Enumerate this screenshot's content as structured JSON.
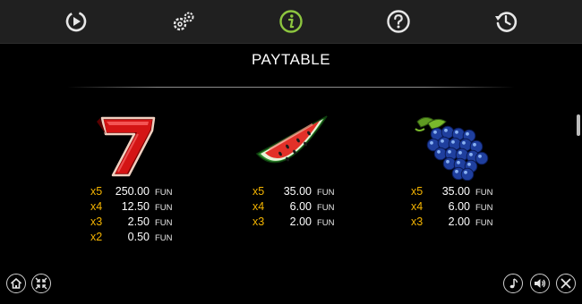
{
  "nav": [
    {
      "id": "autoplay",
      "icon": "replay-icon"
    },
    {
      "id": "settings",
      "icon": "gears-icon"
    },
    {
      "id": "info",
      "icon": "info-icon",
      "active": true,
      "color": "#8dc63f"
    },
    {
      "id": "help",
      "icon": "help-icon"
    },
    {
      "id": "history",
      "icon": "history-icon"
    }
  ],
  "title": "PAYTABLE",
  "colors": {
    "multiplier": "#f4b400",
    "active": "#8dc63f",
    "topbar": "#202020"
  },
  "symbols": [
    {
      "name": "seven",
      "icon": "seven-icon",
      "payouts": [
        {
          "mult": "x5",
          "value": "250.00",
          "currency": "FUN"
        },
        {
          "mult": "x4",
          "value": "12.50",
          "currency": "FUN"
        },
        {
          "mult": "x3",
          "value": "2.50",
          "currency": "FUN"
        },
        {
          "mult": "x2",
          "value": "0.50",
          "currency": "FUN"
        }
      ]
    },
    {
      "name": "watermelon",
      "icon": "watermelon-icon",
      "payouts": [
        {
          "mult": "x5",
          "value": "35.00",
          "currency": "FUN"
        },
        {
          "mult": "x4",
          "value": "6.00",
          "currency": "FUN"
        },
        {
          "mult": "x3",
          "value": "2.00",
          "currency": "FUN"
        }
      ]
    },
    {
      "name": "grapes",
      "icon": "grapes-icon",
      "payouts": [
        {
          "mult": "x5",
          "value": "35.00",
          "currency": "FUN"
        },
        {
          "mult": "x4",
          "value": "6.00",
          "currency": "FUN"
        },
        {
          "mult": "x3",
          "value": "2.00",
          "currency": "FUN"
        }
      ]
    }
  ],
  "controls": {
    "left": [
      {
        "icon": "home-icon"
      },
      {
        "icon": "fullscreen-exit-icon"
      }
    ],
    "right": [
      {
        "icon": "music-icon"
      },
      {
        "icon": "sound-icon"
      },
      {
        "icon": "close-icon"
      }
    ]
  }
}
